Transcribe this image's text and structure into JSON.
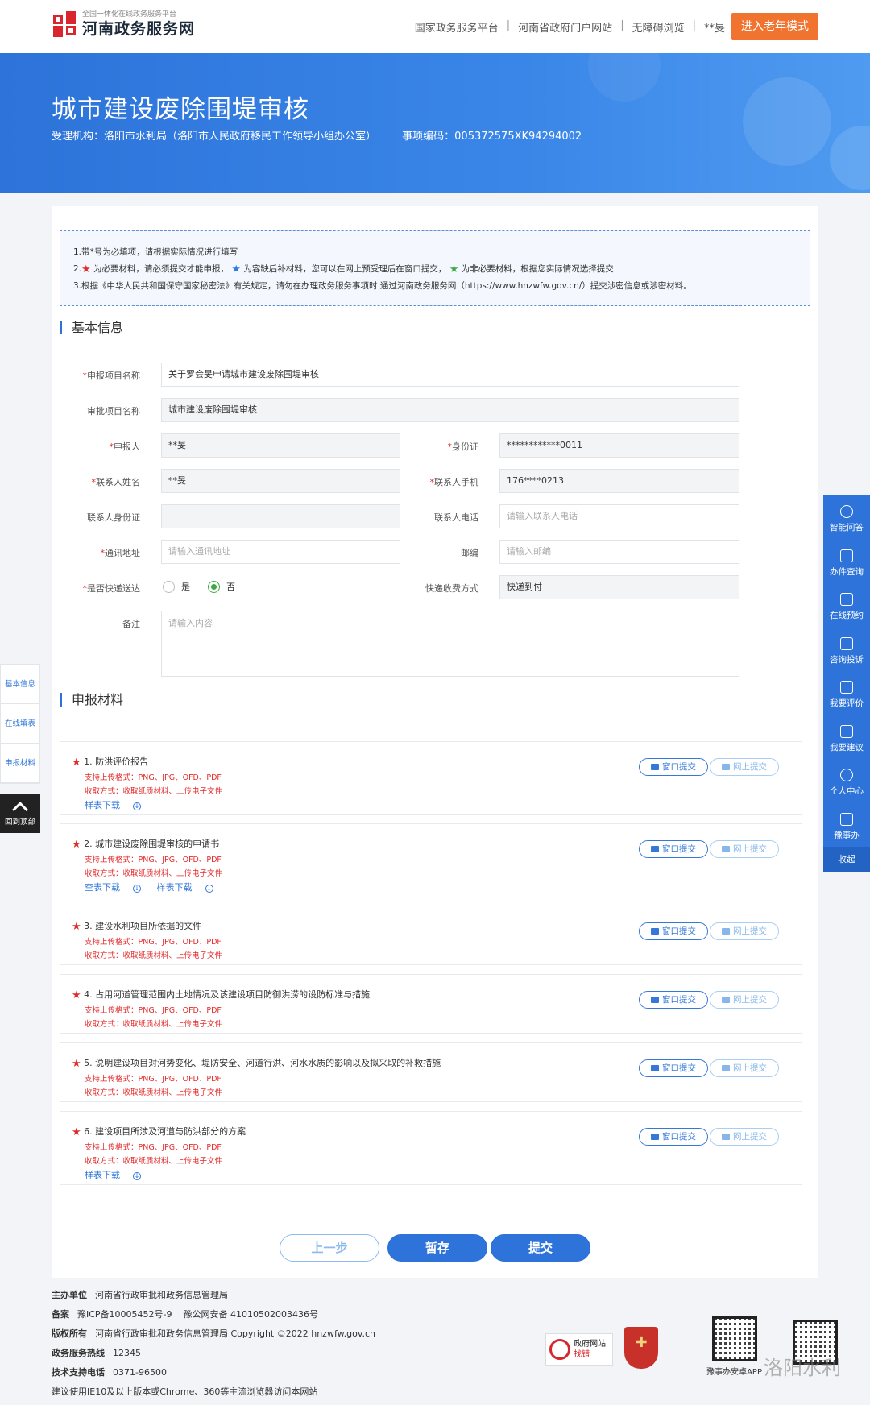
{
  "header": {
    "logo_small": "全国一体化在线政务服务平台",
    "logo_big": "河南政务服务网",
    "nav": [
      "国家政务服务平台",
      "河南省政府门户网站",
      "无障碍浏览"
    ],
    "user": "**旻",
    "elder_mode": "进入老年模式"
  },
  "banner": {
    "title": "城市建设废除围堤审核",
    "agency": "受理机构：洛阳市水利局（洛阳市人民政府移民工作领导小组办公室）",
    "code": "事项编码：005372575XK94294002"
  },
  "notice": {
    "line1": "1.带*号为必填项，请根据实际情况进行填写",
    "line2_prefix": "2.",
    "line2_a": "为必要材料，请必须提交才能申报，",
    "line2_b": "为容缺后补材料，您可以在网上预受理后在窗口提交，",
    "line2_c": "为非必要材料，根据您实际情况选择提交",
    "line3": "3.根据《中华人民共和国保守国家秘密法》有关规定，请勿在办理政务服务事项时 通过河南政务服务网（https://www.hnzwfw.gov.cn/）提交涉密信息或涉密材料。"
  },
  "basic": {
    "section_title": "基本信息",
    "project_name_label": "申报项目名称",
    "project_name_value": "关于罗会旻申请城市建设废除围堤审核",
    "approval_label": "审批项目名称",
    "approval_value": "城市建设废除围堤审核",
    "applicant_label": "申报人",
    "applicant_value": "**旻",
    "id_label": "身份证",
    "id_value": "************0011",
    "contact_name_label": "联系人姓名",
    "contact_name_value": "**旻",
    "contact_phone_label": "联系人手机",
    "contact_phone_value": "176****0213",
    "contact_id_label": "联系人身份证",
    "contact_id_value": "",
    "contact_tel_label": "联系人电话",
    "contact_tel_placeholder": "请输入联系人电话",
    "address_label": "通讯地址",
    "address_placeholder": "请输入通讯地址",
    "postcode_label": "邮编",
    "postcode_placeholder": "请输入邮编",
    "express_label": "是否快递送达",
    "express_yes": "是",
    "express_no": "否",
    "fee_label": "快递收费方式",
    "fee_value": "快递到付",
    "remark_label": "备注",
    "remark_placeholder": "请输入内容"
  },
  "materials": {
    "section_title": "申报材料",
    "format_text": "支持上传格式：PNG、JPG、OFD、PDF",
    "receive_text": "收取方式：收取纸质材料、上传电子文件",
    "window_btn": "窗口提交",
    "online_btn": "网上提交",
    "items": [
      {
        "title": "1. 防洪评价报告",
        "downloads": [
          "样表下载"
        ]
      },
      {
        "title": "2. 城市建设废除围堤审核的申请书",
        "downloads": [
          "空表下载",
          "样表下载"
        ]
      },
      {
        "title": "3. 建设水利项目所依据的文件",
        "downloads": []
      },
      {
        "title": "4. 占用河道管理范围内土地情况及该建设项目防御洪涝的设防标准与措施",
        "downloads": []
      },
      {
        "title": "5. 说明建设项目对河势变化、堤防安全、河道行洪、河水水质的影响以及拟采取的补救措施",
        "downloads": []
      },
      {
        "title": "6. 建设项目所涉及河道与防洪部分的方案",
        "downloads": [
          "样表下载"
        ]
      }
    ]
  },
  "actions": {
    "prev": "上一步",
    "save": "暂存",
    "submit": "提交"
  },
  "footer": {
    "host_label": "主办单位",
    "host": "河南省行政审批和政务信息管理局",
    "record_label": "备案",
    "icp": "豫ICP备10005452号-9",
    "police": "豫公网安备 41010502003436号",
    "copyright_label": "版权所有",
    "copyright": "河南省行政审批和政务信息管理局 Copyright ©2022 hnzwfw.gov.cn",
    "hotline_label": "政务服务热线",
    "hotline": "12345",
    "support_label": "技术支持电话",
    "support": "0371-96500",
    "browser": "建议使用IE10及以上版本或Chrome、360等主流浏览器访问本网站",
    "gov_badge_top": "政府网站",
    "gov_badge_bottom": "找错",
    "app_caption": "豫事办安卓APP",
    "watermark": "洛阳水利"
  },
  "left_nav": {
    "items": [
      "基本信息",
      "在线填表",
      "申报材料"
    ],
    "to_top": "回到顶部"
  },
  "right_nav": {
    "items": [
      "智能问答",
      "办件查询",
      "在线预约",
      "咨询投诉",
      "我要评价",
      "我要建议",
      "个人中心",
      "豫事办"
    ],
    "collapse": "收起"
  }
}
